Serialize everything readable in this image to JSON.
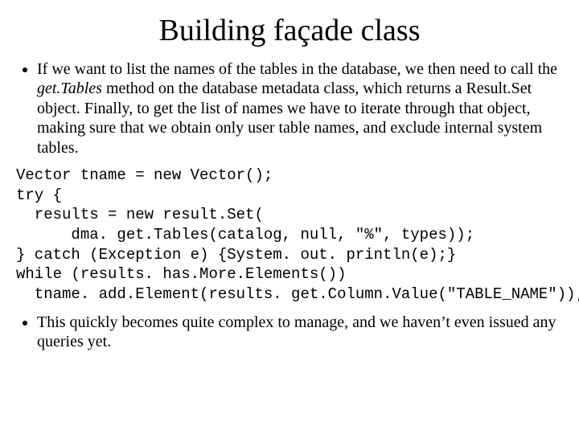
{
  "title": "Building façade class",
  "bullet1_a": "If we want to list the names of the tables in the database, we then need to call the ",
  "bullet1_method": "get.Tables",
  "bullet1_b": " method on the database metadata class, which returns a Result.Set object. Finally, to get the list of names we have to iterate through that object, making sure that we obtain only user table names, and exclude internal system tables.",
  "code": "Vector tname = new Vector();\ntry {\n  results = new result.Set(\n      dma. get.Tables(catalog, null, \"%\", types));\n} catch (Exception e) {System. out. println(e);}\nwhile (results. has.More.Elements())\n  tname. add.Element(results. get.Column.Value(\"TABLE_NAME\"));",
  "bullet2": "This quickly becomes quite complex to manage, and we haven’t even issued any queries yet."
}
